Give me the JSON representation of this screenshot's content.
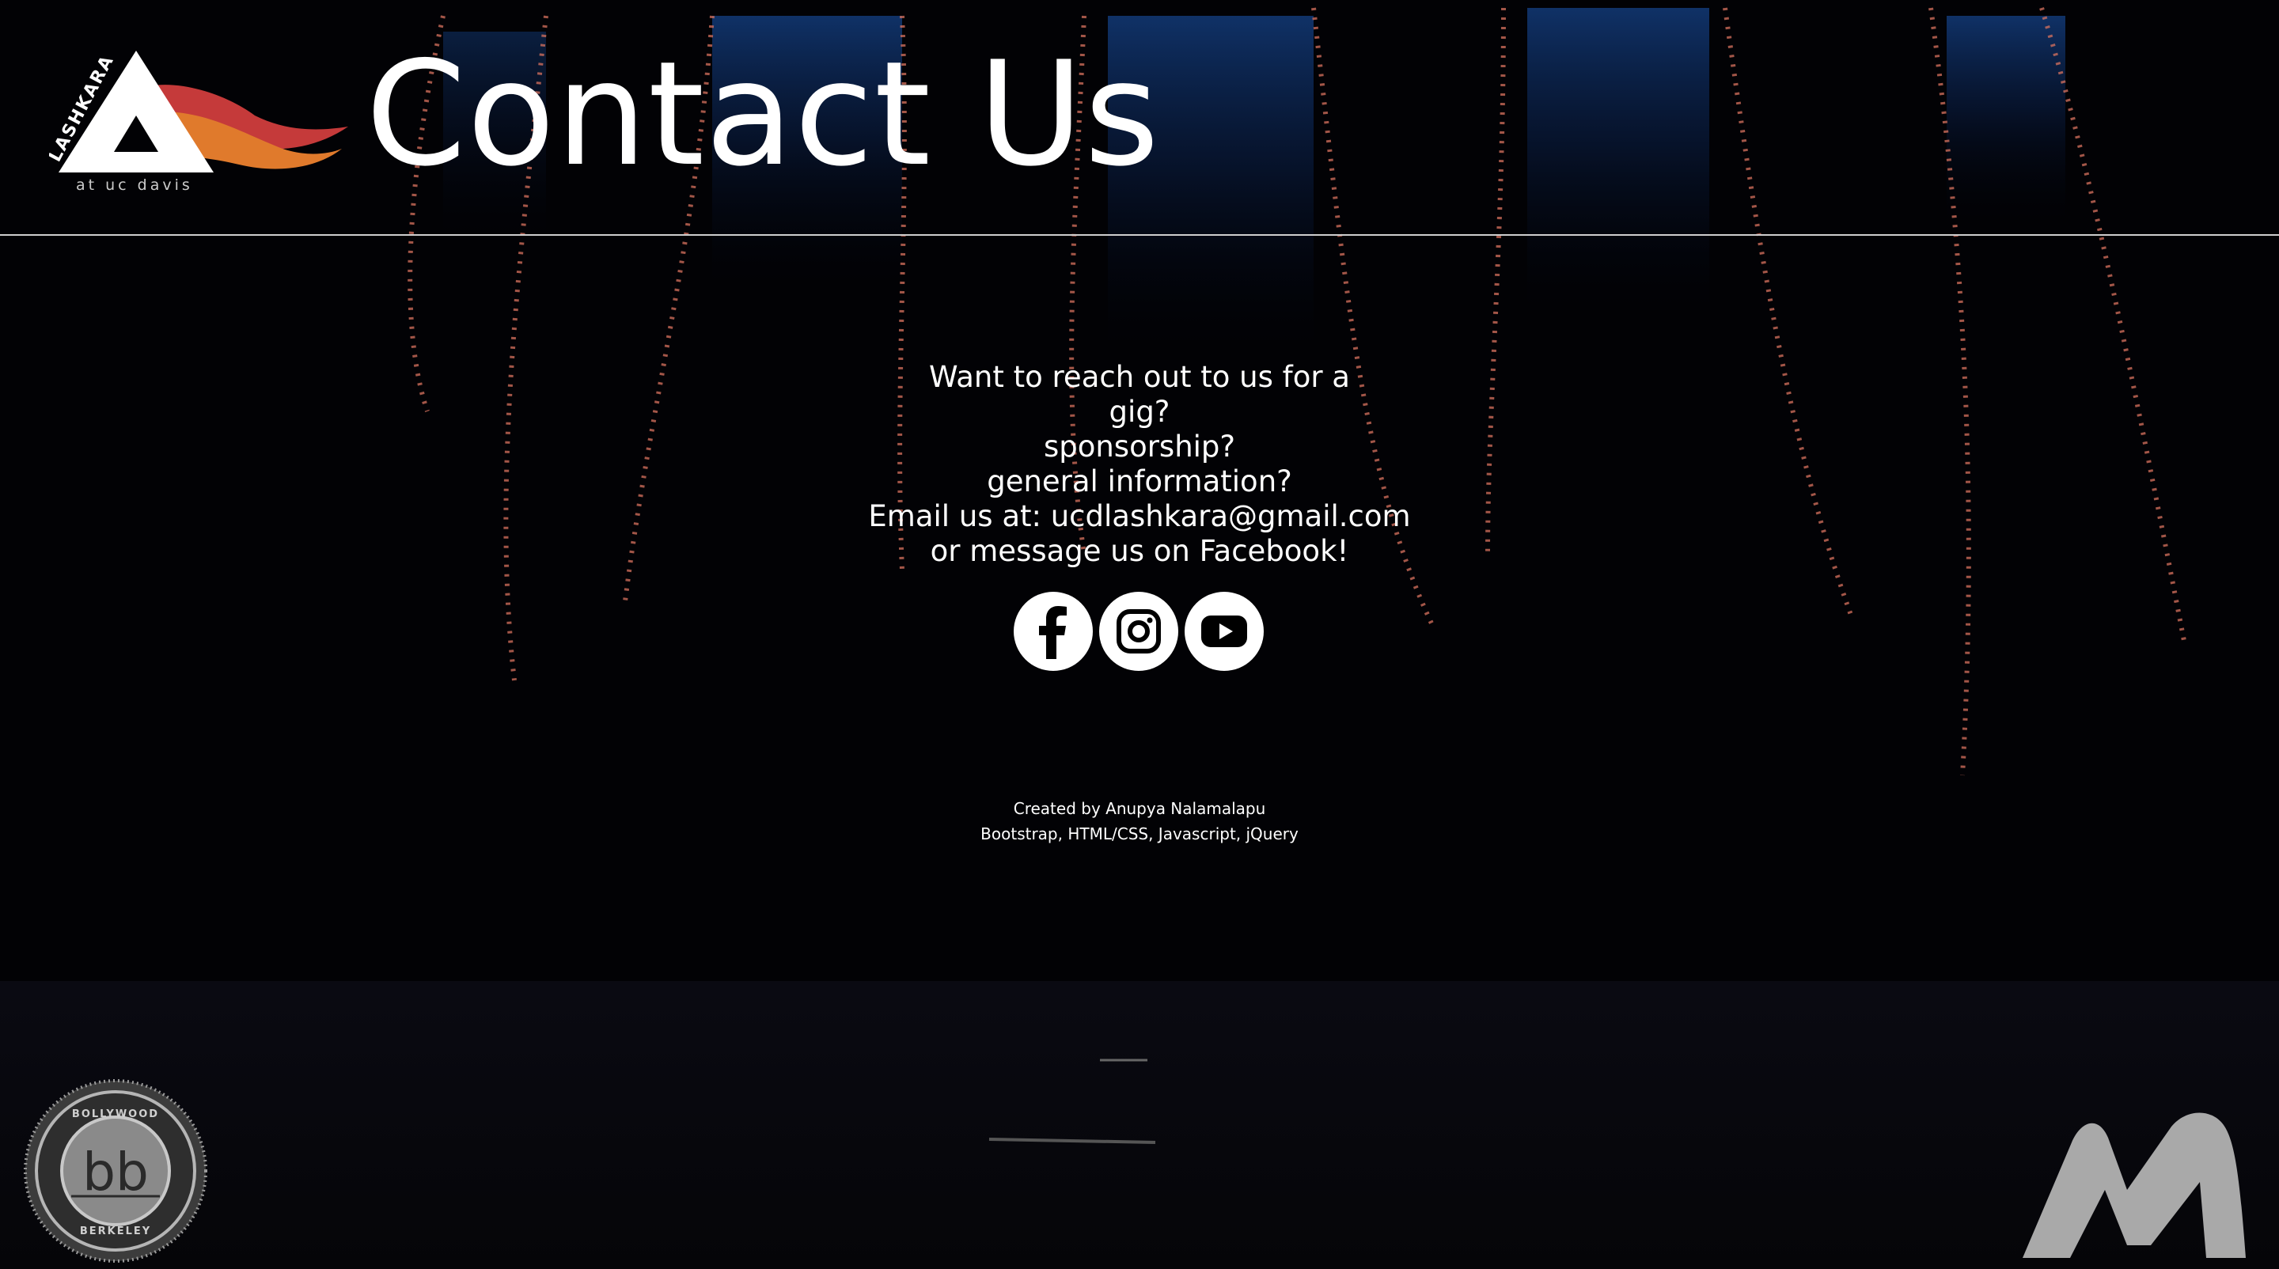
{
  "header": {
    "logo_text": "LASHKARA",
    "logo_subtext": "at uc davis",
    "title": "Contact Us"
  },
  "contact": {
    "lines": [
      "Want to reach out to us for a",
      "gig?",
      "sponsorship?",
      "general information?",
      "Email us at: ucdlashkara@gmail.com",
      "or message us on Facebook!"
    ]
  },
  "social": [
    {
      "name": "facebook",
      "icon": "facebook-icon"
    },
    {
      "name": "instagram",
      "icon": "instagram-icon"
    },
    {
      "name": "youtube",
      "icon": "youtube-icon"
    }
  ],
  "footer": {
    "credit": "Created by Anupya Nalamalapu",
    "stack": "Bootstrap, HTML/CSS, Javascript, jQuery"
  },
  "badges": {
    "bb_top": "BOLLYWOOD",
    "bb_bottom": "BERKELEY",
    "bb_mark": "bb",
    "m_mark": "M"
  },
  "colors": {
    "background": "#020205",
    "curtain": "#0d2a5a",
    "lights": "#d9735f",
    "flame_red": "#c53a3a",
    "flame_orange": "#e07a2c"
  }
}
